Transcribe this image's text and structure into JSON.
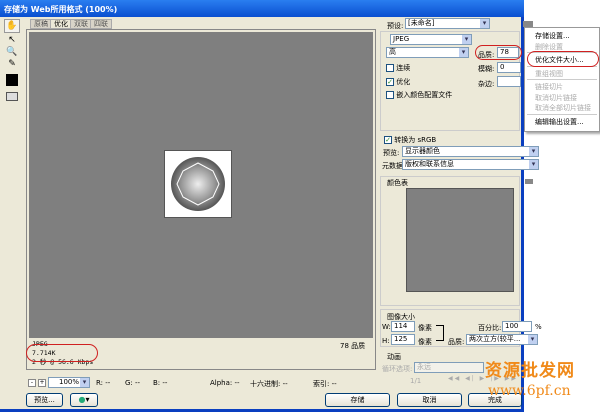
{
  "window": {
    "title": "存储为 Web所用格式 (100%)"
  },
  "tabs": [
    "原稿",
    "优化",
    "双联",
    "四联"
  ],
  "active_tab": 1,
  "tools": [
    "hand-icon",
    "slice-select-icon",
    "zoom-icon",
    "eyedropper-icon"
  ],
  "preview": {
    "format": "JPEG",
    "size": "7.714K",
    "time": "2 秒 @ 56.6 Kbps",
    "quality_label": "78 品质"
  },
  "statusbar": {
    "zoom": "100%",
    "r": "R: --",
    "g": "G: --",
    "b": "B: --",
    "alpha": "Alpha: --",
    "hex": "十六进制: --",
    "index": "索引: --"
  },
  "buttons": {
    "preview": "预览...",
    "save": "存储",
    "cancel": "取消",
    "done": "完成"
  },
  "settings": {
    "preset_label": "预设:",
    "preset": "[未命名]",
    "format": "JPEG",
    "quality_preset": "高",
    "quality_label": "品质:",
    "quality": "78",
    "blur_label": "模糊:",
    "blur": "0",
    "matte_label": "杂边:",
    "progressive": "连续",
    "progressive_checked": false,
    "optimized": "优化",
    "optimized_checked": true,
    "embed_profile": "嵌入颜色配置文件",
    "embed_checked": false,
    "convert_srgb": "转换为 sRGB",
    "convert_checked": true,
    "preview_label": "预览:",
    "preview_value": "显示器颜色",
    "metadata_label": "元数据:",
    "metadata_value": "版权和联系信息",
    "color_table": "颜色表"
  },
  "image_size": {
    "title": "图像大小",
    "w_label": "W:",
    "w": "114",
    "h_label": "H:",
    "h": "125",
    "unit": "像素",
    "percent_label": "百分比:",
    "percent": "100",
    "pct": "%",
    "quality_label": "品质:",
    "quality": "两次立方(较平..."
  },
  "animation": {
    "title": "动画",
    "loop_label": "循环选项:",
    "loop": "永远",
    "frame": "1/1"
  },
  "menu": [
    {
      "label": "存储设置...",
      "enabled": true
    },
    {
      "label": "删除设置",
      "enabled": false
    },
    {
      "sep": true
    },
    {
      "label": "优化文件大小...",
      "enabled": true
    },
    {
      "sep": true
    },
    {
      "label": "重组视图",
      "enabled": false
    },
    {
      "sep": true
    },
    {
      "label": "链接切片",
      "enabled": false
    },
    {
      "label": "取消切片链接",
      "enabled": false
    },
    {
      "label": "取消全部切片链接",
      "enabled": false
    },
    {
      "sep": true
    },
    {
      "label": "编辑输出设置...",
      "enabled": true
    }
  ],
  "watermark": {
    "line1": "资源批发网",
    "line2": "www.6pf.cn"
  }
}
